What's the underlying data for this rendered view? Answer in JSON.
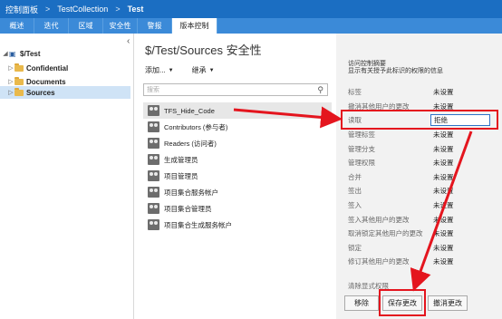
{
  "breadcrumb": [
    "控制面板",
    "TestCollection",
    "Test"
  ],
  "tabs": [
    "概述",
    "迭代",
    "区域",
    "安全性",
    "警报",
    "版本控制"
  ],
  "tree": {
    "root": "$/Test",
    "items": [
      "Confidential",
      "Documents",
      "Sources"
    ]
  },
  "page_title": "$/Test/Sources 安全性",
  "toolbar": {
    "add": "添加...",
    "inherit": "继承"
  },
  "search": {
    "placeholder": "搜索"
  },
  "identities": [
    "TFS_Hide_Code",
    "Contributors (参与者)",
    "Readers (访问者)",
    "生成管理员",
    "项目管理员",
    "项目集合服务帐户",
    "项目集合管理员",
    "项目集合生成服务帐户"
  ],
  "right": {
    "heading": "访问控制摘要",
    "subheading": "显示有关授予此标识的权限的信息",
    "permissions": [
      {
        "name": "标签",
        "value": "未设置"
      },
      {
        "name": "撤消其他用户的更改",
        "value": "未设置"
      },
      {
        "name": "读取",
        "value": "拒绝"
      },
      {
        "name": "管理标签",
        "value": "未设置"
      },
      {
        "name": "管理分支",
        "value": "未设置"
      },
      {
        "name": "管理权限",
        "value": "未设置"
      },
      {
        "name": "合并",
        "value": "未设置"
      },
      {
        "name": "签出",
        "value": "未设置"
      },
      {
        "name": "签入",
        "value": "未设置"
      },
      {
        "name": "签入其他用户的更改",
        "value": "未设置"
      },
      {
        "name": "取消锁定其他用户的更改",
        "value": "未设置"
      },
      {
        "name": "锁定",
        "value": "未设置"
      },
      {
        "name": "修订其他用户的更改",
        "value": "未设置"
      }
    ],
    "clear_label": "清除显式权限",
    "buttons": {
      "remove": "移除",
      "save": "保存更改",
      "undo": "撤消更改"
    }
  }
}
